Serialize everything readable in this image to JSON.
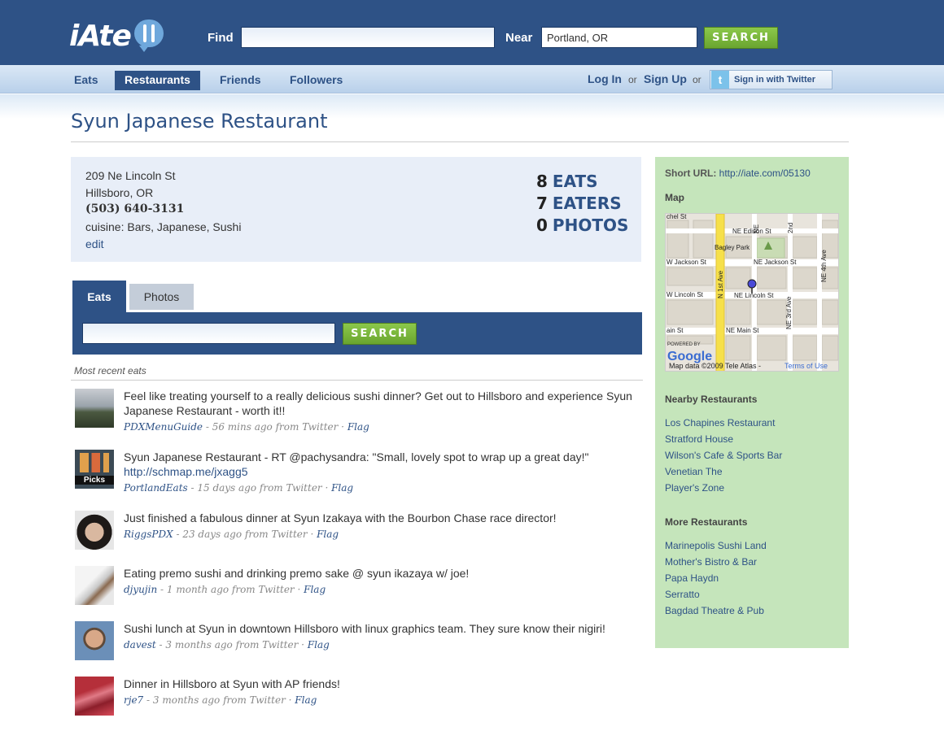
{
  "header": {
    "logo_text": "iAte",
    "find_label": "Find",
    "find_value": "",
    "near_label": "Near",
    "near_value": "Portland, OR",
    "search_label": "SEARCH"
  },
  "nav": {
    "items": [
      {
        "label": "Eats",
        "active": false
      },
      {
        "label": "Restaurants",
        "active": true
      },
      {
        "label": "Friends",
        "active": false
      },
      {
        "label": "Followers",
        "active": false
      }
    ],
    "login": "Log In",
    "or": "or",
    "signup": "Sign Up",
    "twitter_icon": "t",
    "twitter_label": "Sign in with Twitter"
  },
  "restaurant": {
    "name": "Syun Japanese Restaurant",
    "address1": "209 Ne Lincoln St",
    "address2": "Hillsboro, OR",
    "phone": "(503) 640-3131",
    "cuisine": "cuisine: Bars, Japanese, Sushi",
    "edit": "edit",
    "stats": {
      "eats_count": "8",
      "eats_label": "EATS",
      "eaters_count": "7",
      "eaters_label": "EATERS",
      "photos_count": "0",
      "photos_label": "PHOTOS"
    }
  },
  "tabs": {
    "eats": "Eats",
    "photos": "Photos",
    "search_label": "SEARCH",
    "search_value": ""
  },
  "feed": {
    "heading": "Most recent eats",
    "items": [
      {
        "text": "Feel like treating yourself to a really delicious sushi dinner? Get out to Hillsboro and experience Syun Japanese Restaurant - worth it!!",
        "user": "PDXMenuGuide",
        "time": " - 56 mins ago from Twitter · ",
        "flag": "Flag"
      },
      {
        "text": "Syun Japanese Restaurant - RT @pachysandra: \"Small, lovely spot to wrap up a great day!\"",
        "url": "http://schmap.me/jxagg5",
        "user": "PortlandEats",
        "time": " - 15 days ago from Twitter · ",
        "flag": "Flag",
        "avatar_label": "Picks"
      },
      {
        "text": "Just finished a fabulous dinner at Syun Izakaya with the Bourbon Chase race director!",
        "user": "RiggsPDX",
        "time": " - 23 days ago from Twitter · ",
        "flag": "Flag"
      },
      {
        "text": "Eating premo sushi and drinking premo sake @ syun ikazaya w/ joe!",
        "user": "djyujin",
        "time": " - 1 month ago from Twitter · ",
        "flag": "Flag"
      },
      {
        "text": "Sushi lunch at Syun in downtown Hillsboro with linux graphics team. They sure know their nigiri!",
        "user": "davest",
        "time": " - 3 months ago from Twitter · ",
        "flag": "Flag"
      },
      {
        "text": "Dinner in Hillsboro at Syun with AP friends!",
        "user": "rje7",
        "time": " - 3 months ago from Twitter · ",
        "flag": "Flag"
      }
    ]
  },
  "sidebar": {
    "short_url_label": "Short URL:",
    "short_url": "http://iate.com/05130",
    "map_heading": "Map",
    "map": {
      "streets": [
        "NE Edison St",
        "Bagley Park",
        "W Jackson St",
        "NE Jackson St",
        "W Lincoln St",
        "NE Lincoln St",
        "E Main St",
        "NE Main St",
        "N 1st Ave",
        "NE 3rd Ave",
        "NE 4th Ave",
        "NE 2nd Ave"
      ],
      "powered_by": "POWERED BY",
      "google": "Google",
      "attribution": "Map data ©2009 Tele Atlas - Terms of Use"
    },
    "nearby_heading": "Nearby Restaurants",
    "nearby": [
      "Los Chapines Restaurant",
      "Stratford House",
      "Wilson's Cafe & Sports Bar",
      "Venetian The",
      "Player's Zone"
    ],
    "more_heading": "More Restaurants",
    "more": [
      "Marinepolis Sushi Land",
      "Mother's Bistro & Bar",
      "Papa Haydn",
      "Serratto",
      "Bagdad Theatre & Pub"
    ]
  },
  "colors": {
    "header_blue": "#2e5286",
    "sidebar_green": "#c5e5bb",
    "button_green": "#7ab83d"
  }
}
